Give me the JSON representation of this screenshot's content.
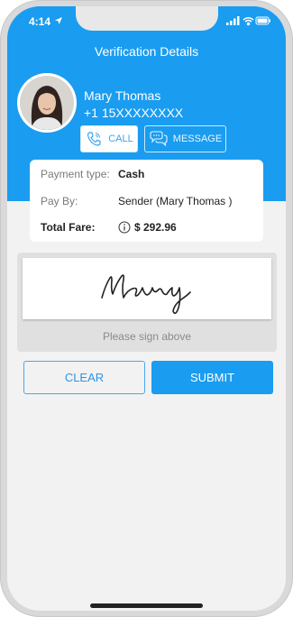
{
  "status_bar": {
    "time": "4:14"
  },
  "header": {
    "title": "Verification Details"
  },
  "user": {
    "name": "Mary Thomas",
    "phone": "+1 15XXXXXXXX"
  },
  "actions": {
    "call_label": "CALL",
    "message_label": "MESSAGE"
  },
  "fare": {
    "payment_type_label": "Payment type:",
    "payment_type_value": "Cash",
    "pay_by_label": "Pay By:",
    "pay_by_value": "Sender (Mary Thomas )",
    "total_label": "Total Fare:",
    "total_value": "$ 292.96"
  },
  "signature": {
    "signed_text": "Mary",
    "hint": "Please sign above"
  },
  "buttons": {
    "clear_label": "CLEAR",
    "submit_label": "SUBMIT"
  },
  "colors": {
    "primary": "#1a9cf0",
    "background": "#f2f2f2"
  }
}
